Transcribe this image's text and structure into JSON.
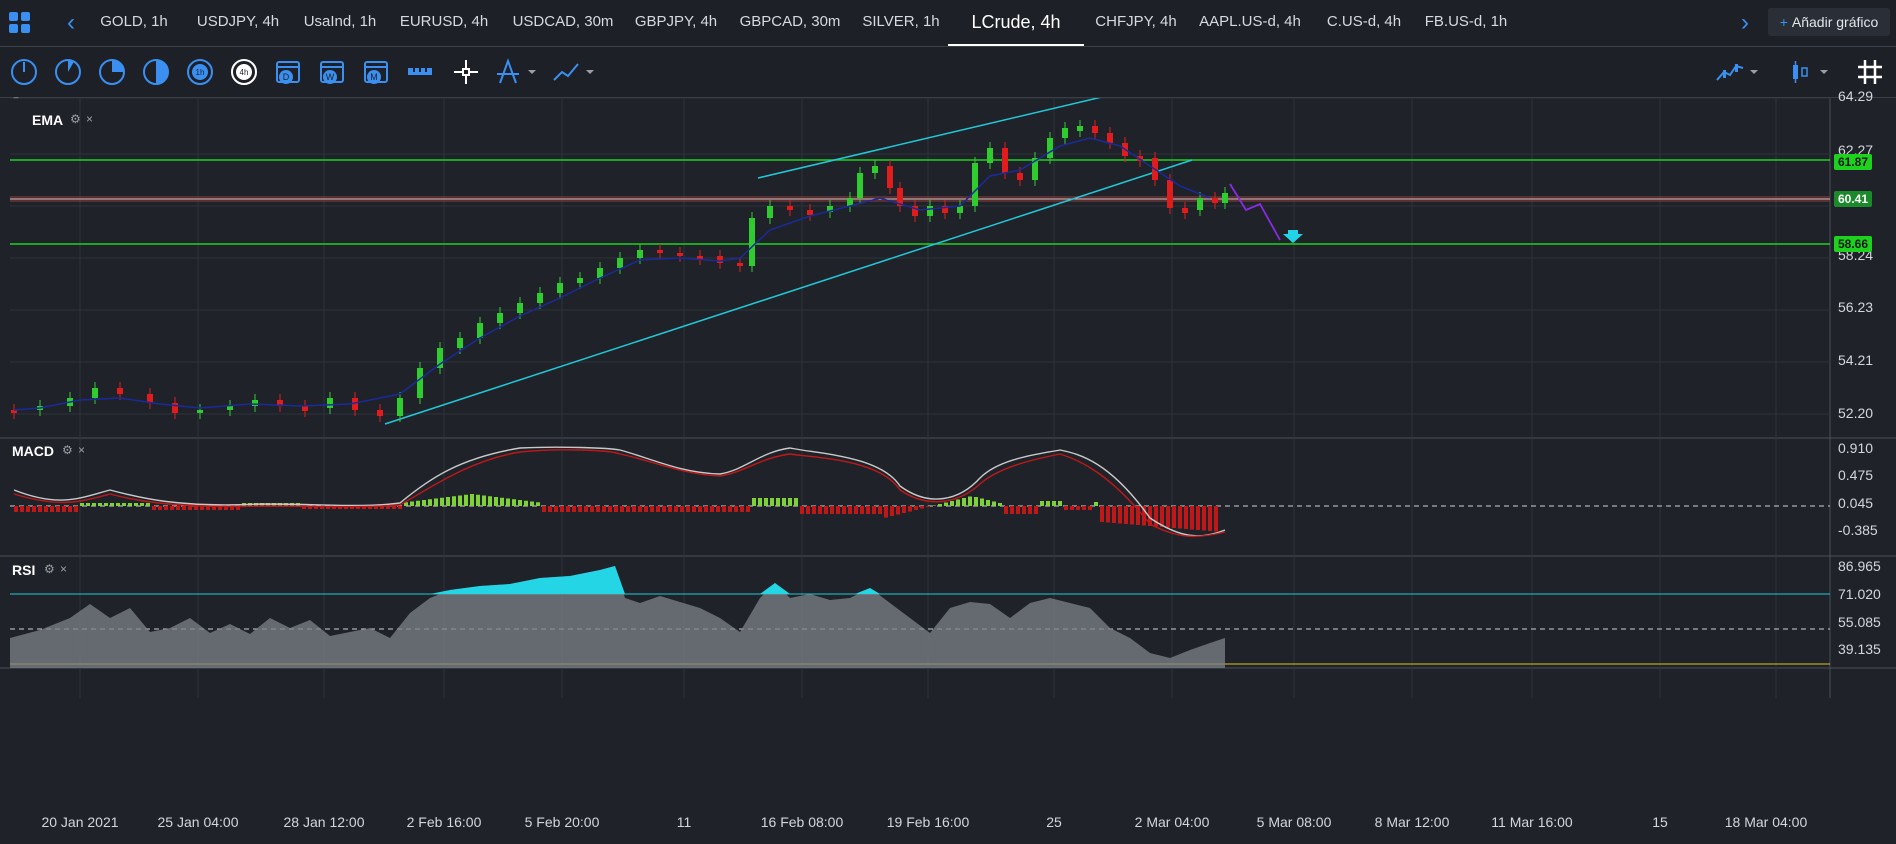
{
  "tabs": [
    {
      "label": "GOLD, 1h",
      "active": false
    },
    {
      "label": "USDJPY, 4h",
      "active": false
    },
    {
      "label": "UsaInd, 1h",
      "active": false
    },
    {
      "label": "EURUSD, 4h",
      "active": false
    },
    {
      "label": "USDCAD, 30m",
      "active": false
    },
    {
      "label": "GBPJPY, 4h",
      "active": false
    },
    {
      "label": "GBPCAD, 30m",
      "active": false
    },
    {
      "label": "SILVER, 1h",
      "active": false
    },
    {
      "label": "LCrude, 4h",
      "active": true
    },
    {
      "label": "CHFJPY, 4h",
      "active": false
    },
    {
      "label": "AAPL.US-d, 4h",
      "active": false
    },
    {
      "label": "C.US-d, 4h",
      "active": false
    },
    {
      "label": "FB.US-d, 1h",
      "active": false
    }
  ],
  "add_chart_label": "Añadir gráfico",
  "add_chart_plus": "+",
  "nav": {
    "prev": "‹",
    "next": "›"
  },
  "toolbar_timeframes": [
    {
      "icon": "clock-1m-icon"
    },
    {
      "icon": "clock-5m-icon"
    },
    {
      "icon": "clock-15m-icon"
    },
    {
      "icon": "clock-30m-icon"
    },
    {
      "icon": "clock-1h-icon",
      "label": "1h"
    },
    {
      "icon": "clock-4h-icon",
      "label": "4h",
      "selected": true
    },
    {
      "icon": "calendar-d-icon",
      "label": "D"
    },
    {
      "icon": "calendar-w-icon",
      "label": "W"
    },
    {
      "icon": "calendar-m-icon",
      "label": "M"
    }
  ],
  "panels": {
    "price": {
      "label": "EMA",
      "close_icon": "×",
      "settings_icon": "gear-icon"
    },
    "macd": {
      "label": "MACD",
      "close_icon": "×",
      "settings_icon": "gear-icon"
    },
    "rsi": {
      "label": "RSI",
      "close_icon": "×",
      "settings_icon": "gear-icon"
    }
  },
  "price_axis": [
    "64.29",
    "62.27",
    "60.41",
    "58.24",
    "56.23",
    "54.21",
    "52.20"
  ],
  "price_tags": [
    {
      "value": "61.87",
      "bg": "#1fd11f",
      "color": "#0b1a0b"
    },
    {
      "value": "60.41",
      "bg": "#1a8a2a",
      "color": "#ffffff"
    },
    {
      "value": "58.66",
      "bg": "#1fd11f",
      "color": "#0b1a0b"
    }
  ],
  "macd_axis": [
    "0.910",
    "0.475",
    "0.045",
    "-0.385"
  ],
  "rsi_axis": [
    "86.965",
    "71.020",
    "55.085",
    "39.135"
  ],
  "time_axis": [
    "20 Jan 2021",
    "25 Jan 04:00",
    "28 Jan 12:00",
    "2 Feb 16:00",
    "5 Feb 20:00",
    "11",
    "16 Feb 08:00",
    "19 Feb 16:00",
    "25",
    "2 Mar 04:00",
    "5 Mar 08:00",
    "8 Mar 12:00",
    "11 Mar 16:00",
    "15",
    "18 Mar 04:00"
  ],
  "colors": {
    "up": "#2ecc2e",
    "down": "#e01c1c",
    "ema": "#1a2a9a",
    "channel": "#22c8d8",
    "hline": "#1fd11f",
    "rsi_fill": "#7d8188",
    "rsi_over": "#23d5e5",
    "projection": "#8a2be2",
    "arrow": "#22d4e8"
  }
}
